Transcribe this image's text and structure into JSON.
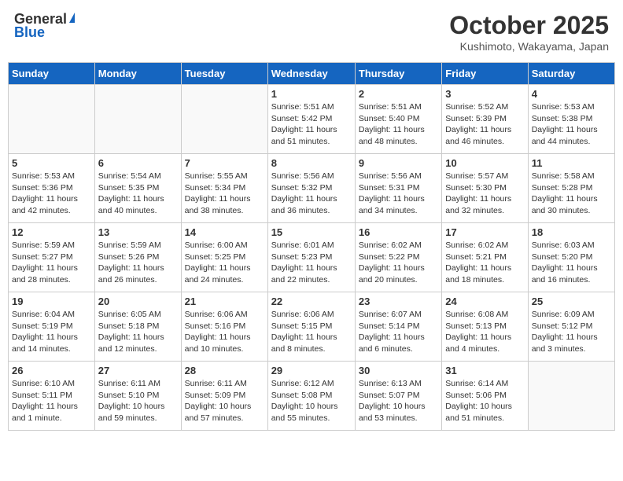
{
  "header": {
    "logo_general": "General",
    "logo_blue": "Blue",
    "month": "October 2025",
    "location": "Kushimoto, Wakayama, Japan"
  },
  "days_of_week": [
    "Sunday",
    "Monday",
    "Tuesday",
    "Wednesday",
    "Thursday",
    "Friday",
    "Saturday"
  ],
  "weeks": [
    [
      {
        "day": "",
        "details": ""
      },
      {
        "day": "",
        "details": ""
      },
      {
        "day": "",
        "details": ""
      },
      {
        "day": "1",
        "details": "Sunrise: 5:51 AM\nSunset: 5:42 PM\nDaylight: 11 hours\nand 51 minutes."
      },
      {
        "day": "2",
        "details": "Sunrise: 5:51 AM\nSunset: 5:40 PM\nDaylight: 11 hours\nand 48 minutes."
      },
      {
        "day": "3",
        "details": "Sunrise: 5:52 AM\nSunset: 5:39 PM\nDaylight: 11 hours\nand 46 minutes."
      },
      {
        "day": "4",
        "details": "Sunrise: 5:53 AM\nSunset: 5:38 PM\nDaylight: 11 hours\nand 44 minutes."
      }
    ],
    [
      {
        "day": "5",
        "details": "Sunrise: 5:53 AM\nSunset: 5:36 PM\nDaylight: 11 hours\nand 42 minutes."
      },
      {
        "day": "6",
        "details": "Sunrise: 5:54 AM\nSunset: 5:35 PM\nDaylight: 11 hours\nand 40 minutes."
      },
      {
        "day": "7",
        "details": "Sunrise: 5:55 AM\nSunset: 5:34 PM\nDaylight: 11 hours\nand 38 minutes."
      },
      {
        "day": "8",
        "details": "Sunrise: 5:56 AM\nSunset: 5:32 PM\nDaylight: 11 hours\nand 36 minutes."
      },
      {
        "day": "9",
        "details": "Sunrise: 5:56 AM\nSunset: 5:31 PM\nDaylight: 11 hours\nand 34 minutes."
      },
      {
        "day": "10",
        "details": "Sunrise: 5:57 AM\nSunset: 5:30 PM\nDaylight: 11 hours\nand 32 minutes."
      },
      {
        "day": "11",
        "details": "Sunrise: 5:58 AM\nSunset: 5:28 PM\nDaylight: 11 hours\nand 30 minutes."
      }
    ],
    [
      {
        "day": "12",
        "details": "Sunrise: 5:59 AM\nSunset: 5:27 PM\nDaylight: 11 hours\nand 28 minutes."
      },
      {
        "day": "13",
        "details": "Sunrise: 5:59 AM\nSunset: 5:26 PM\nDaylight: 11 hours\nand 26 minutes."
      },
      {
        "day": "14",
        "details": "Sunrise: 6:00 AM\nSunset: 5:25 PM\nDaylight: 11 hours\nand 24 minutes."
      },
      {
        "day": "15",
        "details": "Sunrise: 6:01 AM\nSunset: 5:23 PM\nDaylight: 11 hours\nand 22 minutes."
      },
      {
        "day": "16",
        "details": "Sunrise: 6:02 AM\nSunset: 5:22 PM\nDaylight: 11 hours\nand 20 minutes."
      },
      {
        "day": "17",
        "details": "Sunrise: 6:02 AM\nSunset: 5:21 PM\nDaylight: 11 hours\nand 18 minutes."
      },
      {
        "day": "18",
        "details": "Sunrise: 6:03 AM\nSunset: 5:20 PM\nDaylight: 11 hours\nand 16 minutes."
      }
    ],
    [
      {
        "day": "19",
        "details": "Sunrise: 6:04 AM\nSunset: 5:19 PM\nDaylight: 11 hours\nand 14 minutes."
      },
      {
        "day": "20",
        "details": "Sunrise: 6:05 AM\nSunset: 5:18 PM\nDaylight: 11 hours\nand 12 minutes."
      },
      {
        "day": "21",
        "details": "Sunrise: 6:06 AM\nSunset: 5:16 PM\nDaylight: 11 hours\nand 10 minutes."
      },
      {
        "day": "22",
        "details": "Sunrise: 6:06 AM\nSunset: 5:15 PM\nDaylight: 11 hours\nand 8 minutes."
      },
      {
        "day": "23",
        "details": "Sunrise: 6:07 AM\nSunset: 5:14 PM\nDaylight: 11 hours\nand 6 minutes."
      },
      {
        "day": "24",
        "details": "Sunrise: 6:08 AM\nSunset: 5:13 PM\nDaylight: 11 hours\nand 4 minutes."
      },
      {
        "day": "25",
        "details": "Sunrise: 6:09 AM\nSunset: 5:12 PM\nDaylight: 11 hours\nand 3 minutes."
      }
    ],
    [
      {
        "day": "26",
        "details": "Sunrise: 6:10 AM\nSunset: 5:11 PM\nDaylight: 11 hours\nand 1 minute."
      },
      {
        "day": "27",
        "details": "Sunrise: 6:11 AM\nSunset: 5:10 PM\nDaylight: 10 hours\nand 59 minutes."
      },
      {
        "day": "28",
        "details": "Sunrise: 6:11 AM\nSunset: 5:09 PM\nDaylight: 10 hours\nand 57 minutes."
      },
      {
        "day": "29",
        "details": "Sunrise: 6:12 AM\nSunset: 5:08 PM\nDaylight: 10 hours\nand 55 minutes."
      },
      {
        "day": "30",
        "details": "Sunrise: 6:13 AM\nSunset: 5:07 PM\nDaylight: 10 hours\nand 53 minutes."
      },
      {
        "day": "31",
        "details": "Sunrise: 6:14 AM\nSunset: 5:06 PM\nDaylight: 10 hours\nand 51 minutes."
      },
      {
        "day": "",
        "details": ""
      }
    ]
  ]
}
